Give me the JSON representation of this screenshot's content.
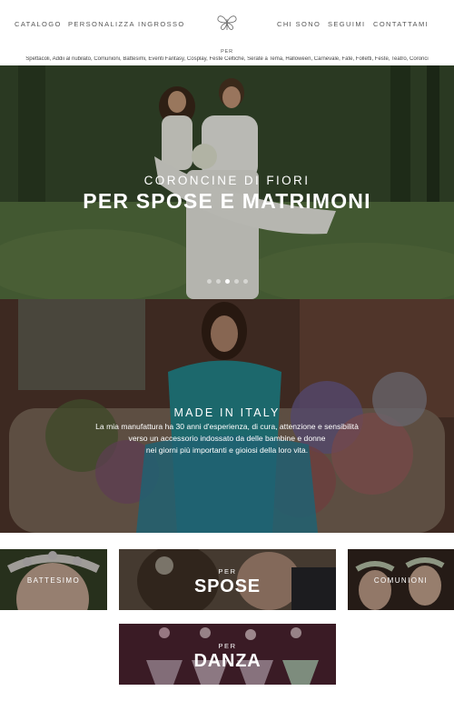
{
  "nav": {
    "left": [
      "CATALOGO",
      "PERSONALIZZA",
      "INGROSSO"
    ],
    "right": [
      "CHI SONO",
      "SEGUIMI",
      "CONTATTAMI"
    ]
  },
  "logo_icon": "butterfly-logo",
  "occasions_header": "PER",
  "occasions_list": "Spettacoli, Addii al nubilato, Comunioni, Battesimi, Eventi Fantasy, Cosplay, Feste Celtiche, Serate a Tema, Halloween, Carnevale, Fate, Folletti, Feste, Teatro, Coronci",
  "hero": {
    "subtitle": "CORONCINE DI FIORI",
    "title": "PER SPOSE E MATRIMONI",
    "slide_count": 5,
    "active_slide": 3
  },
  "made_in_italy": {
    "title": "MADE IN ITALY",
    "lines": [
      "La mia manufattura ha 30 anni d'esperienza, di cura, attenzione e sensibilità",
      "verso un accessorio indossato da delle bambine e donne",
      "nei giorni più importanti e gioiosi della loro vita."
    ]
  },
  "tiles": {
    "battesimo": "BATTESIMO",
    "spose_per": "PER",
    "spose": "SPOSE",
    "comunioni": "COMUNIONI",
    "danza_per": "PER",
    "danza": "DANZA"
  },
  "colors": {
    "nav_text": "#555555",
    "overlay_text": "#ffffff",
    "dot_active": "#ffffff"
  }
}
